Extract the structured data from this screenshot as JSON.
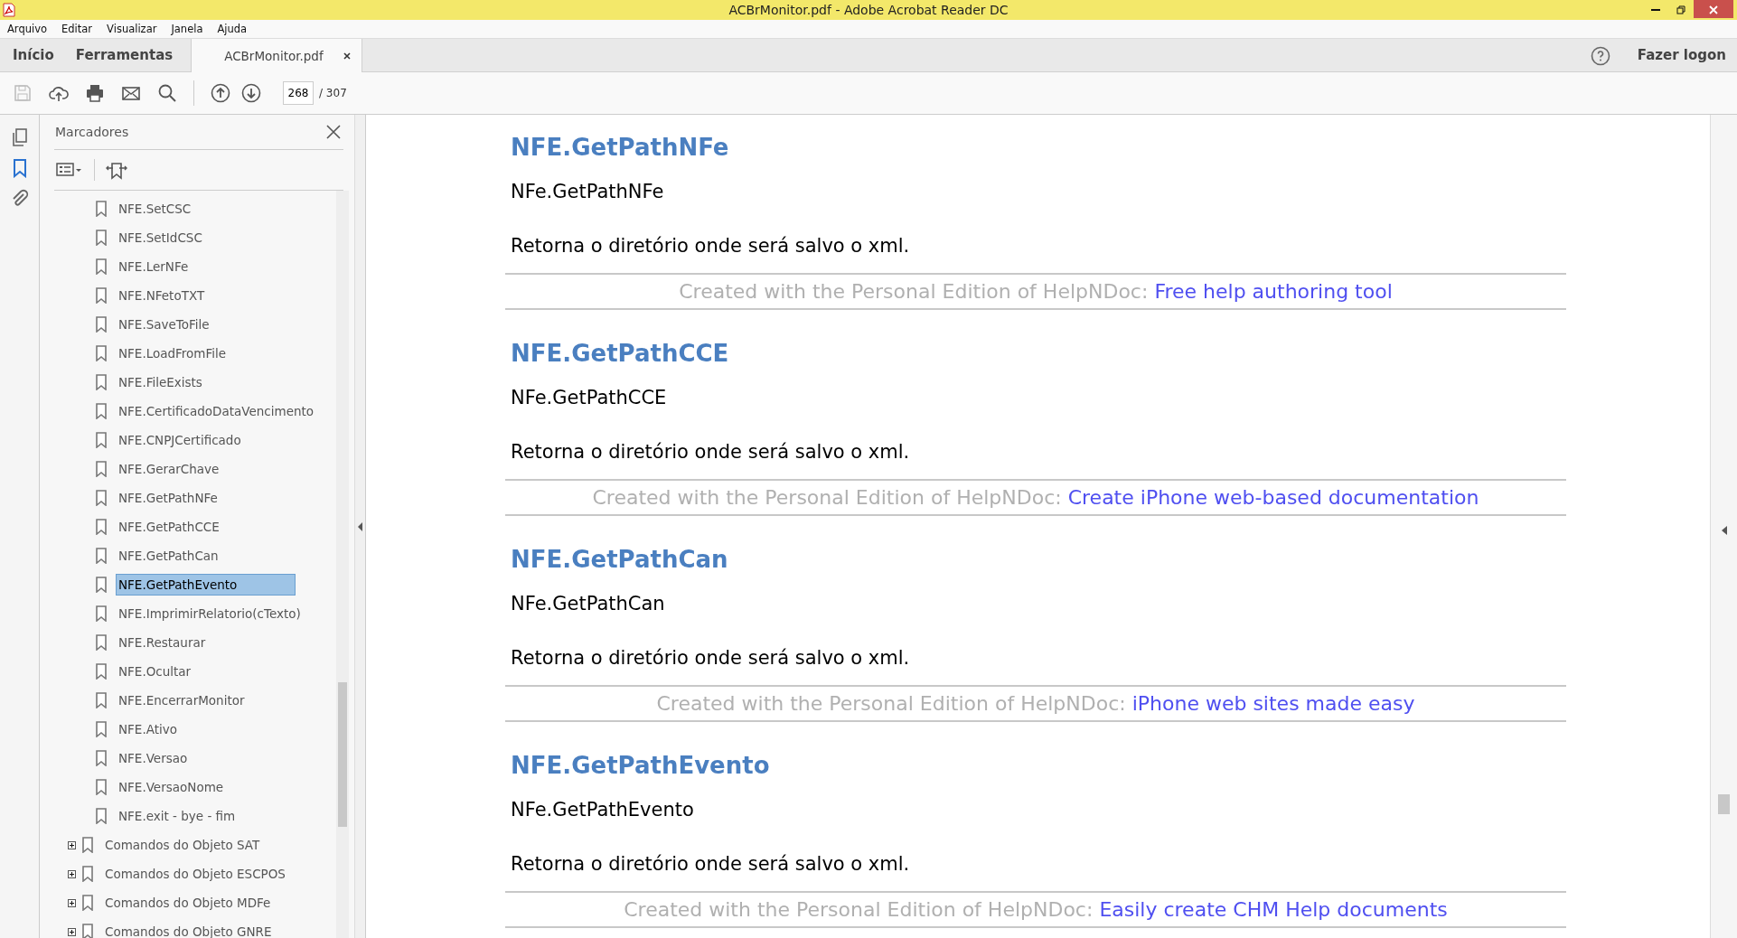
{
  "window": {
    "title": "ACBrMonitor.pdf - Adobe Acrobat Reader DC"
  },
  "menu": [
    "Arquivo",
    "Editar",
    "Visualizar",
    "Janela",
    "Ajuda"
  ],
  "tabs": [
    {
      "label": "Início",
      "kind": "nav",
      "selected": false
    },
    {
      "label": "Ferramentas",
      "kind": "nav",
      "selected": false
    },
    {
      "label": "ACBrMonitor.pdf",
      "kind": "document",
      "selected": true
    }
  ],
  "sign_in": "Fazer logon",
  "page_nav": {
    "current": "268",
    "total": "/ 307"
  },
  "sidebar": {
    "title": "Marcadores",
    "bookmark_children": [
      {
        "label": "NFE.SetCSC",
        "selected": false
      },
      {
        "label": "NFE.SetIdCSC",
        "selected": false
      },
      {
        "label": "NFE.LerNFe",
        "selected": false
      },
      {
        "label": "NFE.NFetoTXT",
        "selected": false
      },
      {
        "label": "NFE.SaveToFile",
        "selected": false
      },
      {
        "label": "NFE.LoadFromFile",
        "selected": false
      },
      {
        "label": "NFE.FileExists",
        "selected": false
      },
      {
        "label": "NFE.CertificadoDataVencimento",
        "selected": false
      },
      {
        "label": "NFE.CNPJCertificado",
        "selected": false
      },
      {
        "label": "NFE.GerarChave",
        "selected": false
      },
      {
        "label": "NFE.GetPathNFe",
        "selected": false
      },
      {
        "label": "NFE.GetPathCCE",
        "selected": false
      },
      {
        "label": "NFE.GetPathCan",
        "selected": false
      },
      {
        "label": "NFE.GetPathEvento",
        "selected": true
      },
      {
        "label": "NFE.ImprimirRelatorio(cTexto)",
        "selected": false
      },
      {
        "label": "NFE.Restaurar",
        "selected": false
      },
      {
        "label": "NFE.Ocultar",
        "selected": false
      },
      {
        "label": "NFE.EncerrarMonitor",
        "selected": false
      },
      {
        "label": "NFE.Ativo",
        "selected": false
      },
      {
        "label": "NFE.Versao",
        "selected": false
      },
      {
        "label": "NFE.VersaoNome",
        "selected": false
      },
      {
        "label": "NFE.exit - bye - fim",
        "selected": false
      }
    ],
    "bookmarks": [
      {
        "label": "Comandos do Objeto SAT",
        "expanded": false
      },
      {
        "label": "Comandos do Objeto ESCPOS",
        "expanded": false
      },
      {
        "label": "Comandos do Objeto MDFe",
        "expanded": false
      },
      {
        "label": "Comandos do Objeto GNRE",
        "expanded": false
      }
    ]
  },
  "document": {
    "sections": [
      {
        "heading": "NFE.GetPathNFe",
        "code": "NFe.GetPathNFe",
        "description": "Retorna o diretório onde será salvo o xml.",
        "footer": "Created with the Personal Edition of HelpNDoc:",
        "footer_link": "Free help authoring tool"
      },
      {
        "heading": "NFE.GetPathCCE",
        "code": "NFe.GetPathCCE",
        "description": "Retorna o diretório onde será salvo o xml.",
        "footer": "Created with the Personal Edition of HelpNDoc:",
        "footer_link": "Create iPhone web-based documentation"
      },
      {
        "heading": "NFE.GetPathCan",
        "code": "NFe.GetPathCan",
        "description": "Retorna o diretório onde será salvo o xml.",
        "footer": "Created with the Personal Edition of HelpNDoc:",
        "footer_link": "iPhone web sites made easy"
      },
      {
        "heading": "NFE.GetPathEvento",
        "code": "NFe.GetPathEvento",
        "description": "Retorna o diretório onde será salvo o xml.",
        "footer": "Created with the Personal Edition of HelpNDoc:",
        "footer_link": "Easily create CHM Help documents"
      }
    ]
  }
}
